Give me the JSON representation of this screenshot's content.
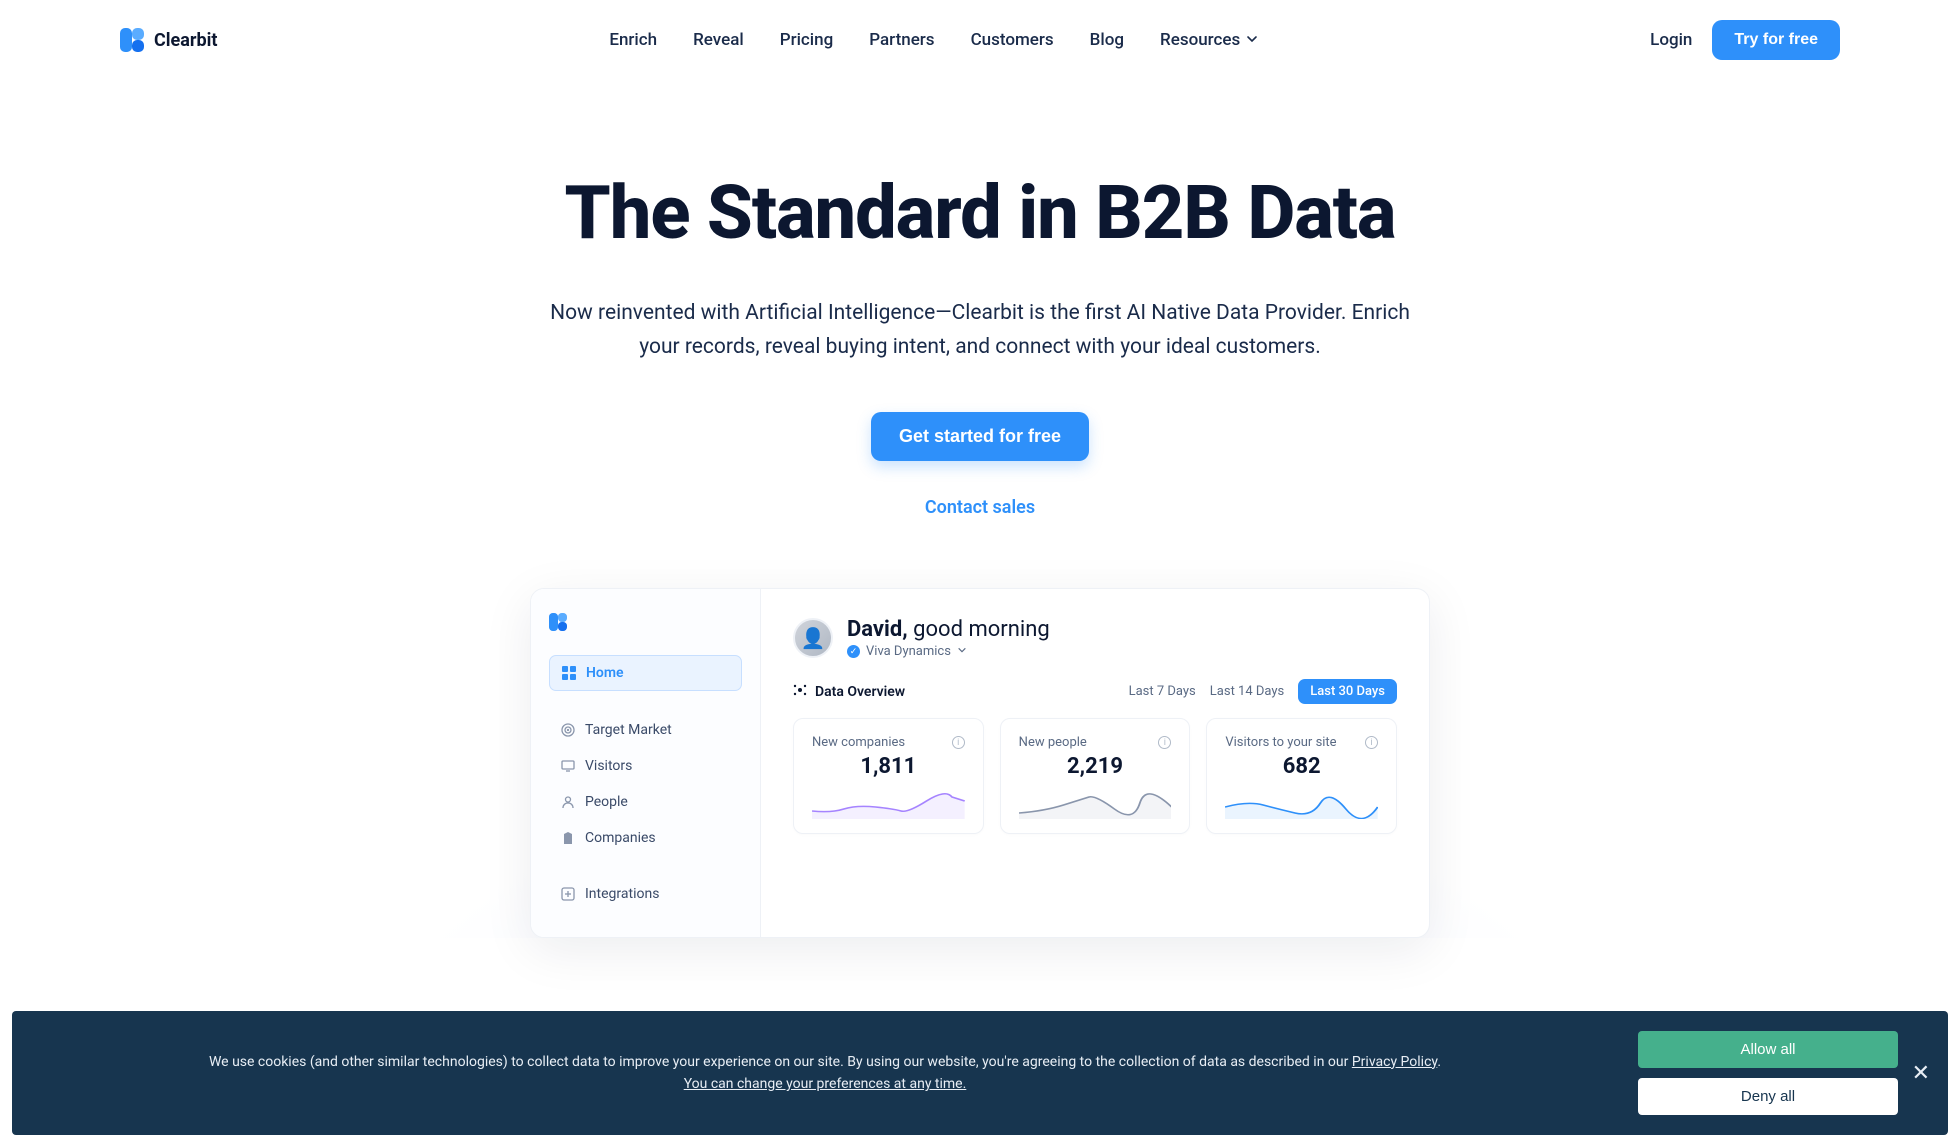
{
  "brand": "Clearbit",
  "nav": {
    "items": [
      "Enrich",
      "Reveal",
      "Pricing",
      "Partners",
      "Customers",
      "Blog",
      "Resources"
    ]
  },
  "auth": {
    "login": "Login",
    "try": "Try for free"
  },
  "hero": {
    "title": "The Standard in B2B Data",
    "sub": "Now reinvented with Artificial Intelligence—Clearbit is the first AI Native Data Provider. Enrich your records, reveal buying intent, and connect with your ideal customers.",
    "cta": "Get started for free",
    "contact": "Contact sales"
  },
  "dashboard": {
    "sidebar": {
      "items": [
        {
          "label": "Home",
          "icon": "grid"
        },
        {
          "label": "Target Market",
          "icon": "target"
        },
        {
          "label": "Visitors",
          "icon": "monitor"
        },
        {
          "label": "People",
          "icon": "user"
        },
        {
          "label": "Companies",
          "icon": "building"
        },
        {
          "label": "Integrations",
          "icon": "plus"
        }
      ]
    },
    "greeting": {
      "name": "David,",
      "message": "good morning",
      "company": "Viva Dynamics"
    },
    "overview_label": "Data Overview",
    "periods": [
      "Last 7 Days",
      "Last 14 Days",
      "Last 30 Days"
    ],
    "cards": [
      {
        "title": "New companies",
        "value": "1,811"
      },
      {
        "title": "New people",
        "value": "2,219"
      },
      {
        "title": "Visitors to your site",
        "value": "682"
      }
    ]
  },
  "cookie": {
    "text1": "We use cookies (and other similar technologies) to collect data to improve your experience on our site. By using our website, you're agreeing to the collection of data as described in our",
    "privacy": "Privacy Policy",
    "text2": "You can change your preferences at any time.",
    "allow": "Allow all",
    "deny": "Deny all"
  }
}
